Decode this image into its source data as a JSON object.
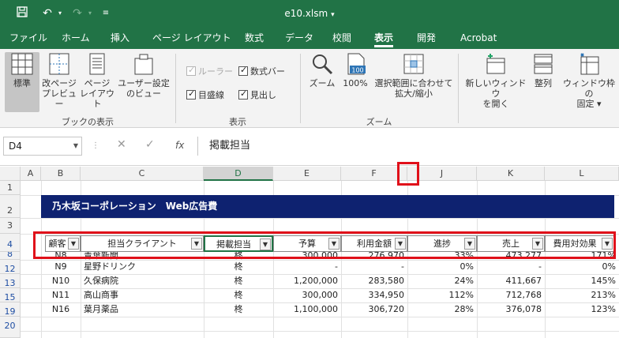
{
  "titlebar": {
    "filename": "e10.xlsm",
    "save_icon": "save-icon",
    "undo_icon": "undo-icon",
    "redo_icon": "redo-icon",
    "customize_icon": "customize-qat-icon"
  },
  "tabs": [
    "ファイル",
    "ホーム",
    "挿入",
    "ページ レイアウト",
    "数式",
    "データ",
    "校閲",
    "表示",
    "開発",
    "Acrobat"
  ],
  "ribbon": {
    "workbook_views": {
      "label": "ブックの表示",
      "normal": "標準",
      "page_break_1": "改ページ",
      "page_break_2": "プレビュー",
      "page_layout_1": "ページ",
      "page_layout_2": "レイアウト",
      "custom_1": "ユーザー設定",
      "custom_2": "のビュー"
    },
    "show": {
      "label": "表示",
      "ruler": "ルーラー",
      "formula_bar": "数式バー",
      "gridlines": "目盛線",
      "headings": "見出し"
    },
    "zoom": {
      "label": "ズーム",
      "zoom": "ズーム",
      "hundred": "100%",
      "hundred_icon_text": "100",
      "selection_1": "選択範囲に合わせて",
      "selection_2": "拡大/縮小"
    },
    "window": {
      "new_1": "新しいウィンドウ",
      "new_2": "を開く",
      "arrange": "整列",
      "freeze_1": "ウィンドウ枠の",
      "freeze_2": "固定"
    }
  },
  "formula_bar": {
    "name_box": "D4",
    "cancel": "✕",
    "enter": "✓",
    "fx": "fx",
    "value": "掲載担当"
  },
  "columns": [
    "A",
    "B",
    "C",
    "D",
    "E",
    "F",
    "J",
    "K",
    "L"
  ],
  "rows": [
    "1",
    "2",
    "3",
    "4",
    "8",
    "12",
    "13",
    "15",
    "19",
    "20"
  ],
  "banner": "乃木坂コーポレーション　Web広告費",
  "table": {
    "headers": [
      "顧客",
      "担当クライアント",
      "掲載担当",
      "予算",
      "利用金額",
      "進捗",
      "売上",
      "費用対効果"
    ],
    "rows": [
      [
        "N8",
        "青葉新聞",
        "柊",
        "300,000",
        "276,970",
        "33%",
        "473,277",
        "171%"
      ],
      [
        "N9",
        "星野ドリンク",
        "柊",
        "-",
        "-",
        "0%",
        "-",
        "0%"
      ],
      [
        "N10",
        "久保病院",
        "柊",
        "1,200,000",
        "283,580",
        "24%",
        "411,667",
        "145%"
      ],
      [
        "N11",
        "高山商事",
        "柊",
        "300,000",
        "334,950",
        "112%",
        "712,768",
        "213%"
      ],
      [
        "N16",
        "葉月薬品",
        "柊",
        "1,100,000",
        "306,720",
        "28%",
        "376,078",
        "123%"
      ]
    ]
  },
  "colors": {
    "excel_green": "#217346",
    "banner_navy": "#0e2270",
    "highlight_red": "#e0101a"
  }
}
